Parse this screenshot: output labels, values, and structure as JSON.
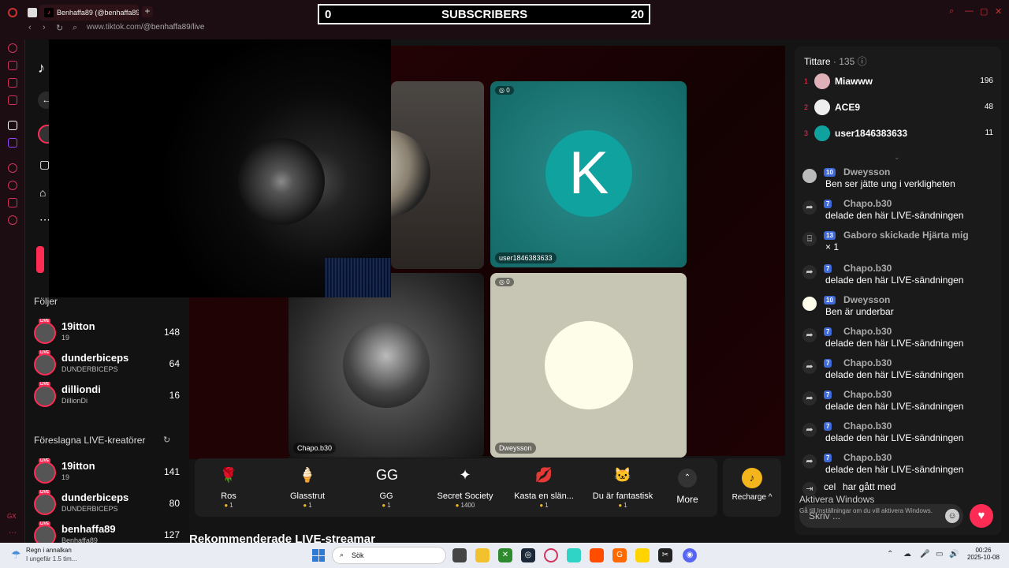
{
  "browser": {
    "tab_title": "Benhaffa89 (@benhaffa89) live",
    "url_domain": "www.tiktok.com",
    "url_path": "/@benhaffa89/live"
  },
  "overlay": {
    "left_value": "0",
    "title": "SUBSCRIBERS",
    "right_value": "20"
  },
  "left_nav": {
    "following_title": "Följer",
    "suggested_title": "Föreslagna LIVE-kreatörer",
    "live_tag": "LIVE",
    "following": [
      {
        "name": "19itton",
        "sub": "19",
        "count": "148"
      },
      {
        "name": "dunderbiceps",
        "sub": "DUNDERBICEPS",
        "count": "64"
      },
      {
        "name": "dilliondi",
        "sub": "DillionDi",
        "count": "16"
      }
    ],
    "suggested": [
      {
        "name": "19itton",
        "sub": "19",
        "count": "141"
      },
      {
        "name": "dunderbiceps",
        "sub": "DUNDERBICEPS",
        "count": "80"
      },
      {
        "name": "benhaffa89",
        "sub": "Benhaffa89",
        "count": "127"
      }
    ]
  },
  "stage": {
    "tiles": [
      {
        "badge": "0",
        "name": "user1846383633",
        "letter": "K"
      },
      {
        "badge": "",
        "name": "Chapo.b30"
      },
      {
        "badge": "0",
        "name": "Dweysson"
      }
    ]
  },
  "gifts": [
    {
      "name": "Ros",
      "price": "1",
      "icon": "🌹"
    },
    {
      "name": "Glasstrut",
      "price": "1",
      "icon": "🍦"
    },
    {
      "name": "GG",
      "price": "1",
      "icon": "GG"
    },
    {
      "name": "Secret Society",
      "price": "1400",
      "icon": "✦"
    },
    {
      "name": "Kasta en slän...",
      "price": "1",
      "icon": "💋"
    },
    {
      "name": "Du är fantastisk",
      "price": "1",
      "icon": "🐱"
    }
  ],
  "gift_more_label": "More",
  "recharge_label": "Recharge ^",
  "recommended_title": "Rekommenderade LIVE-streamar",
  "chat": {
    "viewers_label": "Tittare",
    "viewers_count": "· 135",
    "top_viewers": [
      {
        "rank": "1",
        "name": "Miawww",
        "score": "196"
      },
      {
        "rank": "2",
        "name": "ACE9",
        "score": "48"
      },
      {
        "rank": "3",
        "name": "user1846383633",
        "score": "11"
      }
    ],
    "messages": [
      {
        "level": "10",
        "user": "Dweysson",
        "text": "Ben ser jätte ung i verkligheten",
        "icon": "avatar"
      },
      {
        "level": "7",
        "user": "Chapo.b30",
        "text": "delade den här LIVE-sändningen",
        "icon": "share"
      },
      {
        "level": "13",
        "user": "Gaboro skickade Hjärta mig",
        "text": "× 1",
        "icon": "gift"
      },
      {
        "level": "7",
        "user": "Chapo.b30",
        "text": "delade den här LIVE-sändningen",
        "icon": "share"
      },
      {
        "level": "10",
        "user": "Dweysson",
        "text": "Ben är underbar",
        "icon": "avatar"
      },
      {
        "level": "7",
        "user": "Chapo.b30",
        "text": "delade den här LIVE-sändningen",
        "icon": "share"
      },
      {
        "level": "7",
        "user": "Chapo.b30",
        "text": "delade den här LIVE-sändningen",
        "icon": "share"
      },
      {
        "level": "7",
        "user": "Chapo.b30",
        "text": "delade den här LIVE-sändningen",
        "icon": "share"
      },
      {
        "level": "7",
        "user": "Chapo.b30",
        "text": "delade den här LIVE-sändningen",
        "icon": "share"
      },
      {
        "level": "7",
        "user": "Chapo.b30",
        "text": "delade den här LIVE-sändningen",
        "icon": "share"
      }
    ],
    "join_user": "cel",
    "join_text": "har gått med",
    "comment_placeholder": "Skriv ..."
  },
  "windows_activation": {
    "title": "Aktivera Windows",
    "sub": "Gå till Inställningar om du vill aktivera Windows."
  },
  "taskbar": {
    "weather_line1": "Regn i annalkan",
    "weather_line2": "I ungefär 1.5 tim...",
    "search_label": "Sök",
    "time": "00:26",
    "date": "2025-10-08",
    "tray_label": "GX"
  },
  "colors": {
    "accent": "#fe2c55",
    "level_badge": "#3f6ad8",
    "coin": "#f3b51b"
  }
}
